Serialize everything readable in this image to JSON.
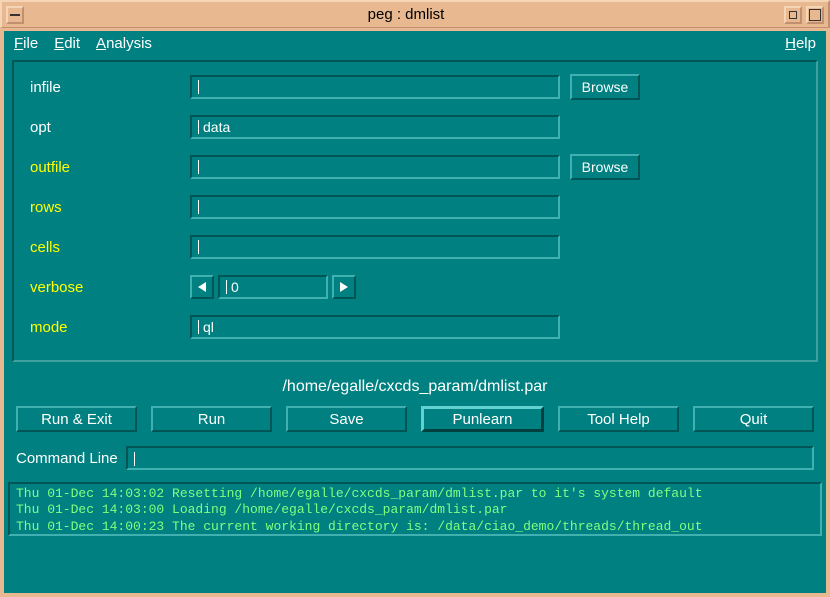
{
  "window": {
    "title": "peg : dmlist"
  },
  "menu": {
    "file": "File",
    "edit": "Edit",
    "analysis": "Analysis",
    "help": "Help"
  },
  "params": {
    "infile": {
      "label": "infile",
      "value": "",
      "browse": "Browse"
    },
    "opt": {
      "label": "opt",
      "value": "data"
    },
    "outfile": {
      "label": "outfile",
      "value": "",
      "browse": "Browse"
    },
    "rows": {
      "label": "rows",
      "value": ""
    },
    "cells": {
      "label": "cells",
      "value": ""
    },
    "verbose": {
      "label": "verbose",
      "value": "0"
    },
    "mode": {
      "label": "mode",
      "value": "ql"
    }
  },
  "path": "/home/egalle/cxcds_param/dmlist.par",
  "buttons": {
    "runexit": "Run & Exit",
    "run": "Run",
    "save": "Save",
    "punlearn": "Punlearn",
    "toolhelp": "Tool Help",
    "quit": "Quit"
  },
  "cmd": {
    "label": "Command Line",
    "value": ""
  },
  "log": "Thu 01-Dec 14:03:02 Resetting /home/egalle/cxcds_param/dmlist.par to it's system default\nThu 01-Dec 14:03:00 Loading /home/egalle/cxcds_param/dmlist.par\nThu 01-Dec 14:00:23 The current working directory is: /data/ciao_demo/threads/thread_out"
}
